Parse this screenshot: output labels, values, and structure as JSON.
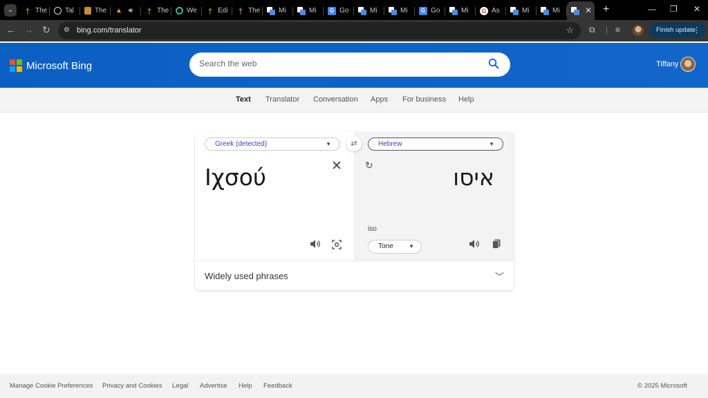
{
  "browser": {
    "tabs": [
      {
        "title": "The",
        "favicon": "cross-icon"
      },
      {
        "title": "Tal",
        "favicon": "globe-icon"
      },
      {
        "title": "The",
        "favicon": "book-icon"
      },
      {
        "title": "",
        "favicon": "hat-icon",
        "audio": "speaker-icon"
      },
      {
        "title": "The",
        "favicon": "cross-icon"
      },
      {
        "title": "We",
        "favicon": "chatgpt-icon"
      },
      {
        "title": "Edi",
        "favicon": "cross-icon"
      },
      {
        "title": "The",
        "favicon": "cross-icon"
      },
      {
        "title": "Mi",
        "favicon": "ms-translator-icon"
      },
      {
        "title": "Mi",
        "favicon": "ms-translator-icon"
      },
      {
        "title": "Go",
        "favicon": "google-translate-icon"
      },
      {
        "title": "Mi",
        "favicon": "ms-translator-icon"
      },
      {
        "title": "Mi",
        "favicon": "ms-translator-icon"
      },
      {
        "title": "Go",
        "favicon": "google-translate-icon"
      },
      {
        "title": "Mi",
        "favicon": "ms-translator-icon"
      },
      {
        "title": "As",
        "favicon": "google-icon"
      },
      {
        "title": "Mi",
        "favicon": "ms-translator-icon"
      },
      {
        "title": "Mi",
        "favicon": "ms-translator-icon"
      }
    ],
    "new_tab_glyph": "+",
    "url": "bing.com/translator",
    "update_button": "Finish update"
  },
  "header": {
    "brand": "Microsoft Bing",
    "search_placeholder": "Search the web",
    "user_name": "Tiffany"
  },
  "subnav": {
    "items": [
      "Text",
      "Translator",
      "Conversation",
      "Apps",
      "For business",
      "Help"
    ],
    "active_index": 0
  },
  "translator": {
    "source_language": "Greek (detected)",
    "target_language": "Hebrew",
    "source_text": "Ιχσού",
    "translated_text": "איסו",
    "transliteration": "iso",
    "tone_label": "Tone",
    "phrases_label": "Widely used phrases"
  },
  "footer": {
    "links": [
      "Manage Cookie Preferences",
      "Privacy and Cookies",
      "Legal",
      "Advertise",
      "Help",
      "Feedback"
    ],
    "copyright": "© 2025 Microsoft"
  },
  "colors": {
    "header_blue": "#0b5fc2",
    "language_link": "#3f3fc0",
    "update_button": "#0d3a5c"
  }
}
